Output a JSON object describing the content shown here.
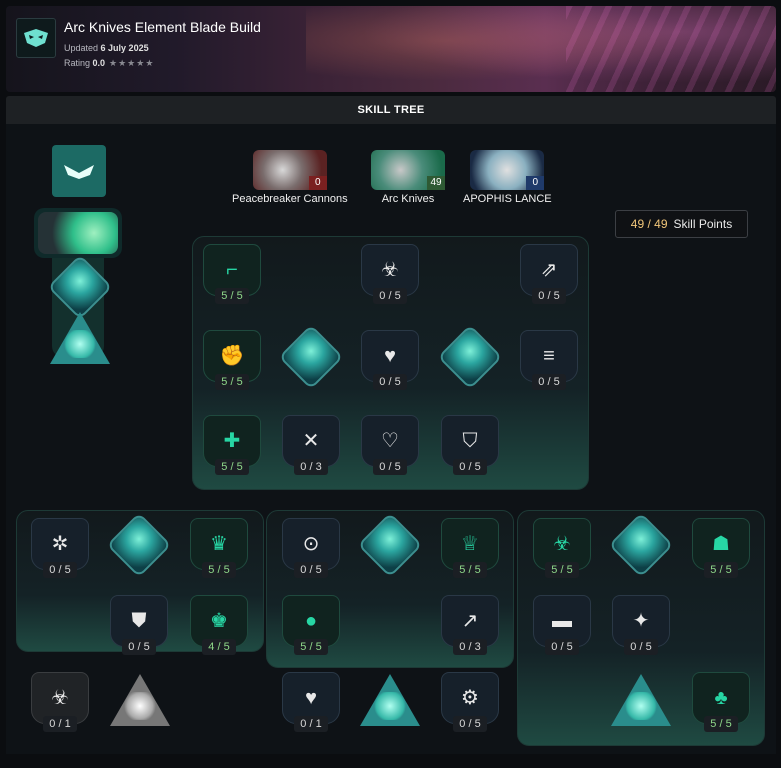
{
  "header": {
    "title": "Arc Knives Element Blade Build",
    "updated_label": "Updated",
    "updated_date": "6 July 2025",
    "rating_label": "Rating",
    "rating_value": "0.0",
    "stars": "★★★★★"
  },
  "tree_title": "SKILL TREE",
  "action_skills": [
    {
      "name": "Peacebreaker Cannons",
      "points": "0",
      "badge_color": "#7a2020"
    },
    {
      "name": "Arc Knives",
      "points": "49",
      "badge_color": "#2e5a34"
    },
    {
      "name": "APOPHIS LANCE",
      "points": "0",
      "badge_color": "#1f3a6a"
    }
  ],
  "skill_points": {
    "current": "49 / 49",
    "label": "Skill Points"
  },
  "colors": {
    "accent_green": "#27d6a4",
    "active_count": "#8fd88a",
    "points_gold": "#f1c67a"
  },
  "top_tree": [
    {
      "icon": "pistol-icon",
      "count": "5 / 5"
    },
    {
      "icon": "biohazard-icon",
      "count": "0 / 5"
    },
    {
      "icon": "boot-icon",
      "count": "0 / 5"
    },
    {
      "icon": "fist-icon",
      "count": "5 / 5"
    },
    {
      "icon": "heart-icon",
      "count": "0 / 5"
    },
    {
      "icon": "gun-stack-icon",
      "count": "0 / 5"
    },
    {
      "icon": "fist-plus-icon",
      "count": "5 / 5"
    },
    {
      "icon": "wings-icon",
      "count": "0 / 3"
    },
    {
      "icon": "heart-burst-icon",
      "count": "0 / 5"
    },
    {
      "icon": "shield-icon",
      "count": "0 / 5"
    }
  ],
  "left_tree": [
    {
      "icon": "star-swirl-icon",
      "count": "0 / 5"
    },
    {
      "icon": "crown-icon",
      "count": "5 / 5"
    },
    {
      "icon": "shield-down-icon",
      "count": "0 / 5"
    },
    {
      "icon": "crown-bolt-icon",
      "count": "4 / 5"
    },
    {
      "icon": "biohazard-icon",
      "count": "0 / 1"
    }
  ],
  "mid_tree": [
    {
      "icon": "pills-icon",
      "count": "0 / 5"
    },
    {
      "icon": "crown-sparks-icon",
      "count": "5 / 5"
    },
    {
      "icon": "grenade-icon",
      "count": "5 / 5"
    },
    {
      "icon": "gun-arrow-icon",
      "count": "0 / 3"
    },
    {
      "icon": "broken-heart-icon",
      "count": "0 / 1"
    },
    {
      "icon": "cog-up-icon",
      "count": "0 / 5"
    }
  ],
  "right_tree": [
    {
      "icon": "biohazard-up-icon",
      "count": "5 / 5"
    },
    {
      "icon": "gas-mask-icon",
      "count": "5 / 5"
    },
    {
      "icon": "mask-icon",
      "count": "0 / 5"
    },
    {
      "icon": "spike-icon",
      "count": "0 / 5"
    },
    {
      "icon": "leaf-up-icon",
      "count": "5 / 5"
    }
  ]
}
